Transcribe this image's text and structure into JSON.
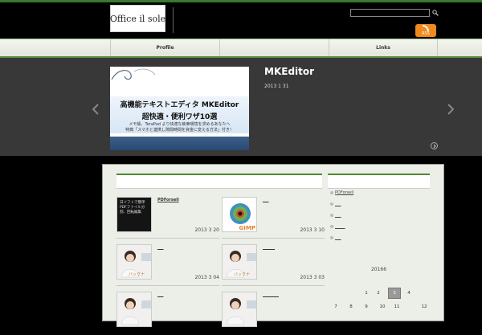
{
  "header": {
    "logo_text": "Office il sole",
    "search": {
      "value": "",
      "placeholder": ""
    },
    "rss_label": "RSS"
  },
  "nav": {
    "items": [
      {
        "label": "Profile"
      },
      {
        "label": ""
      },
      {
        "label": "Links"
      }
    ]
  },
  "slider": {
    "title": "MKEditor",
    "date": "2013 1 31",
    "image": {
      "line1": "高機能テキストエディタ MKEditor",
      "line2": "超快適・便利ワザ10選",
      "line3": "メモ帳、TeraPad より快適な執筆環境を求めるあなたへ",
      "line4": "特典「スマホと連携し隙間時間を資金に変える方法」付き！"
    }
  },
  "posts": [
    {
      "title": "PDForsell",
      "date": "2013 3 20",
      "thumb_text": "日ソフトで簡単PDFファイル分割、回転編集"
    },
    {
      "title": "___",
      "date": "2013 3 10",
      "thumb_text": "GIMP"
    },
    {
      "title": "___",
      "date": "2013 3 04",
      "thumb_text": "バックナ"
    },
    {
      "title": "______",
      "date": "2013 3 03",
      "thumb_text": "バックナ"
    },
    {
      "title": "___",
      "date": "",
      "thumb_text": ""
    },
    {
      "title": "________",
      "date": "",
      "thumb_text": ""
    }
  ],
  "sidebar": {
    "links": [
      "PDForsell",
      "___",
      "___",
      "_____",
      "___"
    ]
  },
  "calendar": {
    "title": "20166",
    "rows": [
      [
        "",
        "",
        "1",
        "2",
        "3",
        "4",
        ""
      ],
      [
        "",
        "7",
        "8",
        "9",
        "10",
        "11",
        "12"
      ]
    ],
    "today": "3"
  },
  "colors": {
    "accent_green": "#4d8a35",
    "rss_orange": "#f08a1c"
  }
}
